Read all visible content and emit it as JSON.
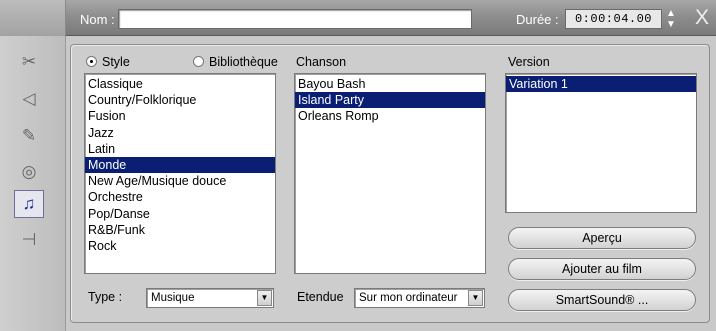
{
  "header": {
    "name_label": "Nom :",
    "name_value": "",
    "duration_label": "Durée :",
    "duration_value": "0:00:04.00",
    "spin_up": "▲",
    "spin_down": "▼",
    "close_glyph": "X"
  },
  "sidebar": {
    "tools": [
      {
        "icon": "video-edit-icon",
        "glyph": "✂"
      },
      {
        "icon": "audio-effect-icon",
        "glyph": "◁"
      },
      {
        "icon": "title-pen-icon",
        "glyph": "✎"
      },
      {
        "icon": "cd-audio-icon",
        "glyph": "◎"
      },
      {
        "icon": "music-note-icon",
        "glyph": "♫",
        "active": true
      },
      {
        "icon": "volume-slider-icon",
        "glyph": "⊣"
      }
    ]
  },
  "source_options": {
    "style_label": "Style",
    "library_label": "Bibliothèque",
    "selected": "Style"
  },
  "style_list": {
    "items": [
      "Classique",
      "Country/Folklorique",
      "Fusion",
      "Jazz",
      "Latin",
      "Monde",
      "New Age/Musique douce",
      "Orchestre",
      "Pop/Danse",
      "R&B/Funk",
      "Rock"
    ],
    "selected": "Monde"
  },
  "song_list": {
    "label": "Chanson",
    "items": [
      "Bayou Bash",
      "Island Party",
      "Orleans Romp"
    ],
    "selected": "Island Party"
  },
  "version_list": {
    "label": "Version",
    "items": [
      "Variation 1"
    ],
    "selected": "Variation 1"
  },
  "buttons": {
    "preview": "Aperçu",
    "add_to_movie": "Ajouter au film",
    "smartsound": "SmartSound® ..."
  },
  "type_combo": {
    "label": "Type :",
    "value": "Musique"
  },
  "scope_combo": {
    "label": "Etendue",
    "value": "Sur mon ordinateur"
  },
  "colors": {
    "selection": "#0a1e74",
    "active_tool": "#1c2fa8"
  }
}
